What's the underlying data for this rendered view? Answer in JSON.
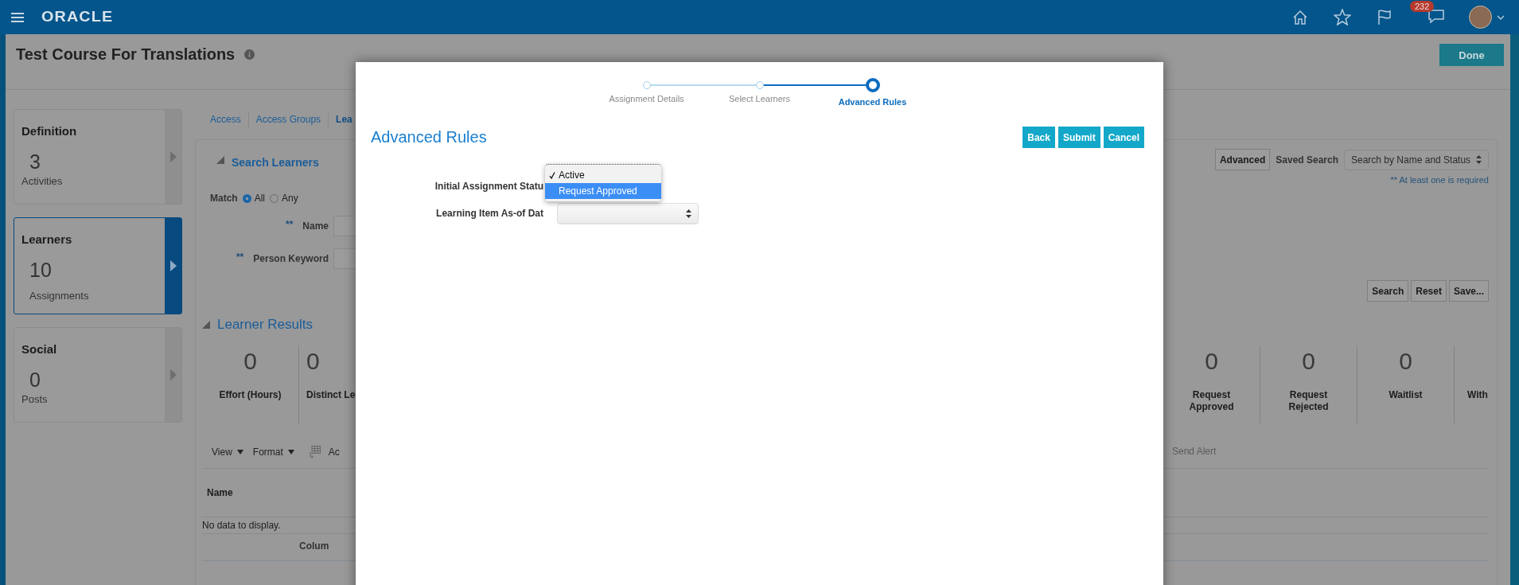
{
  "header": {
    "logo": "ORACLE",
    "notification_count": "232"
  },
  "page": {
    "title": "Test Course For Translations",
    "done_button": "Done"
  },
  "cards": [
    {
      "title": "Definition",
      "count": "3",
      "caption": "Activities",
      "selected": false
    },
    {
      "title": "Learners",
      "count": "10",
      "caption": "Assignments",
      "selected": true
    },
    {
      "title": "Social",
      "count": "0",
      "caption": "Posts",
      "selected": false
    }
  ],
  "tabs": [
    {
      "label": "Access",
      "selected": false
    },
    {
      "label": "Access Groups",
      "selected": false
    },
    {
      "label": "Lea",
      "selected": true
    }
  ],
  "search": {
    "title": "Search Learners",
    "expanded": true,
    "advanced_button": "Advanced",
    "saved_search_label": "Saved Search",
    "saved_search_value": "Search by Name and Status",
    "required_note": "** At least one is required",
    "match_label": "Match",
    "match_options": [
      {
        "label": "All",
        "selected": true
      },
      {
        "label": "Any",
        "selected": false
      }
    ],
    "fields": [
      {
        "marker": "**",
        "label": "Name"
      },
      {
        "marker": "**",
        "label": "Person Keyword"
      }
    ],
    "buttons": [
      "Search",
      "Reset",
      "Save..."
    ]
  },
  "results": {
    "title": "Learner Results",
    "expanded": true,
    "metrics_left": [
      {
        "value": "0",
        "label": "Effort (Hours)"
      },
      {
        "value": "0",
        "label": "Distinct Le"
      }
    ],
    "metrics_right": [
      {
        "value": "0",
        "label": "Request Approved"
      },
      {
        "value": "0",
        "label": "Request Rejected"
      },
      {
        "value": "0",
        "label": "Waitlist"
      },
      {
        "label": "With"
      }
    ]
  },
  "toolbar": {
    "view": "View",
    "format": "Format",
    "action": "Ac",
    "send_alert": "Send Alert"
  },
  "table": {
    "columns": [
      "Name"
    ],
    "empty_message": "No data to display.",
    "footer": "Colum"
  },
  "modal": {
    "steps": [
      {
        "label": "Assignment Details",
        "current": false
      },
      {
        "label": "Select Learners",
        "current": false
      },
      {
        "label": "Advanced Rules",
        "current": true
      }
    ],
    "title": "Advanced Rules",
    "buttons": [
      "Back",
      "Submit",
      "Cancel"
    ],
    "fields": [
      {
        "label": "Initial Assignment Statu"
      },
      {
        "label": "Learning Item As-of Dat"
      }
    ],
    "dropdown": [
      {
        "label": "Active",
        "selected": true,
        "highlighted": false
      },
      {
        "label": "Request Approved",
        "selected": false,
        "highlighted": true
      }
    ]
  }
}
